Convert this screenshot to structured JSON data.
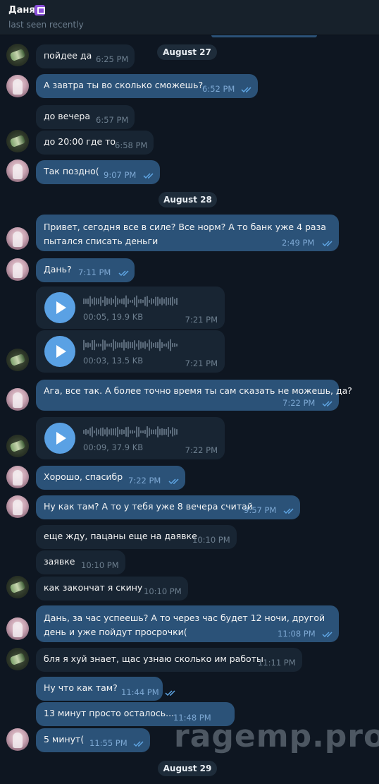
{
  "header": {
    "name": "Даня",
    "status": "last seen recently"
  },
  "dates": [
    "August 27",
    "August 28",
    "August 29"
  ],
  "messages": [
    {
      "text": "пойдее да",
      "time": "6:25 PM"
    },
    {
      "text": "А завтра ты во сколько сможешь?",
      "time": "6:52 PM"
    },
    {
      "text": "до вечера",
      "time": "6:57 PM"
    },
    {
      "text": "до 20:00 где то",
      "time": "6:58 PM"
    },
    {
      "text": "Так поздно(",
      "time": "9:07 PM"
    },
    {
      "text": "Привет, сегодня все в силе? Все норм? А то банк уже 4 раза пытался списать деньги",
      "time": "2:49 PM"
    },
    {
      "text": "Дань?",
      "time": "7:11 PM"
    },
    {
      "duration": "00:05, 19.9 KB",
      "time": "7:21 PM"
    },
    {
      "duration": "00:03, 13.5 KB",
      "time": "7:21 PM"
    },
    {
      "text": "Ага, все так. А более точно время ты сам сказать не можешь, да?",
      "time": "7:22 PM"
    },
    {
      "duration": "00:09, 37.9 KB",
      "time": "7:22 PM"
    },
    {
      "text": "Хорошо, спасибр",
      "time": "7:22 PM"
    },
    {
      "text": "Ну как там? А то у тебя уже 8 вечера считай",
      "time": "9:57 PM"
    },
    {
      "text": "еще жду, пацаны еще на даявке",
      "time": "10:10 PM"
    },
    {
      "text": "заявке",
      "time": "10:10 PM"
    },
    {
      "text": "как закончат я скину",
      "time": "10:10 PM"
    },
    {
      "text": "Дань, за час успеешь? А то через час будет 12 ночи, другой день и уже пойдут просрочки(",
      "time": "11:08 PM"
    },
    {
      "text": "бля я хуй знает, щас узнаю сколько им работы",
      "time": "11:11 PM"
    },
    {
      "text": "Ну что как там?",
      "time": "11:44 PM"
    },
    {
      "text": "13 минут просто осталось...",
      "time": "11:48 PM"
    },
    {
      "text": "5 минут(",
      "time": "11:55 PM"
    }
  ],
  "watermark": "ragemp.pro"
}
